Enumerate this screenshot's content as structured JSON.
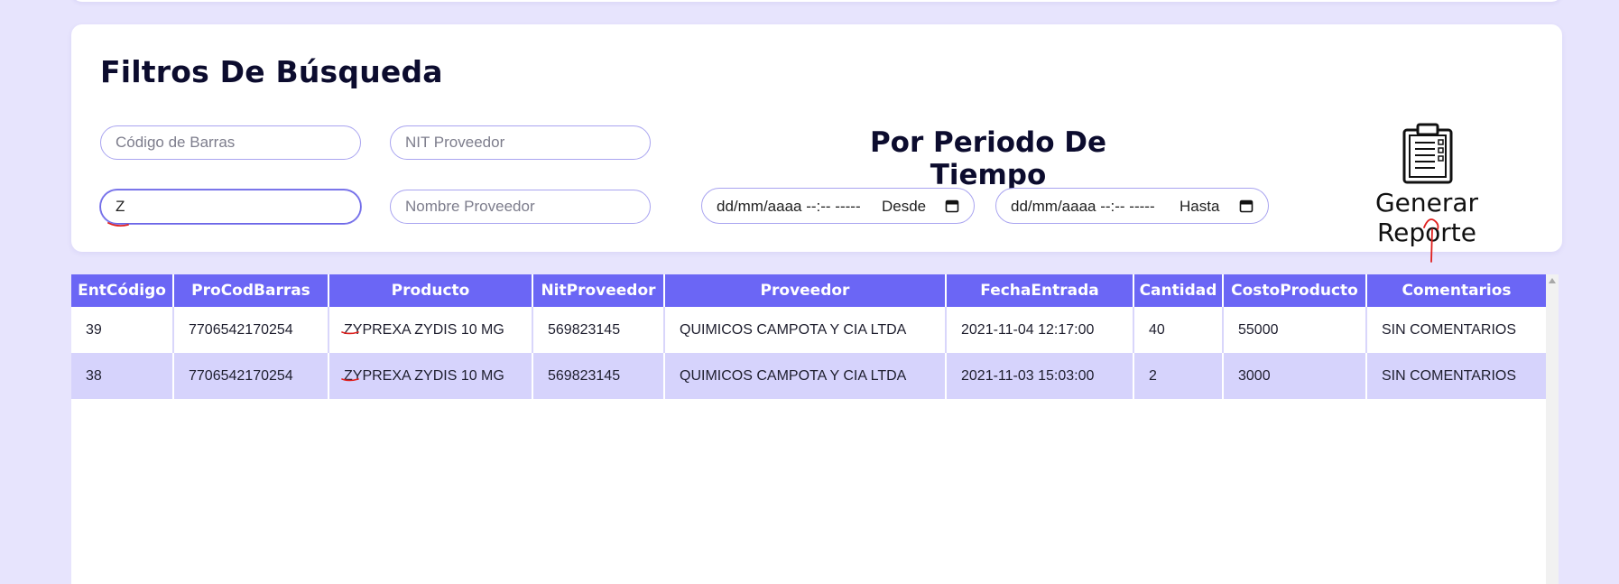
{
  "filters": {
    "title": "Filtros De Búsqueda",
    "barcode_placeholder": "Código de Barras",
    "nit_placeholder": "NIT Proveedor",
    "product_value": "Z",
    "provider_name_placeholder": "Nombre Proveedor"
  },
  "period": {
    "title": "Por Periodo De Tiempo",
    "from_placeholder": "dd/mm/aaaa --:-- -----",
    "from_label": "Desde",
    "to_placeholder": "dd/mm/aaaa --:-- -----",
    "to_label": "Hasta"
  },
  "report": {
    "label": "Generar Reporte",
    "icon": "clipboard-icon"
  },
  "table": {
    "columns": [
      "EntCódigo",
      "ProCodBarras",
      "Producto",
      "NitProveedor",
      "Proveedor",
      "FechaEntrada",
      "Cantidad",
      "CostoProducto",
      "Comentarios"
    ],
    "rows": [
      [
        "39",
        "7706542170254",
        "ZYPREXA ZYDIS 10 MG",
        "569823145",
        "QUIMICOS CAMPOTA Y CIA LTDA",
        "2021-11-04 12:17:00",
        "40",
        "55000",
        "SIN COMENTARIOS"
      ],
      [
        "38",
        "7706542170254",
        "ZYPREXA ZYDIS 10 MG",
        "569823145",
        "QUIMICOS CAMPOTA Y CIA LTDA",
        "2021-11-03 15:03:00",
        "2",
        "3000",
        "SIN COMENTARIOS"
      ]
    ]
  },
  "colors": {
    "page_bg": "#e7e4fd",
    "header_bg": "#6b66f5",
    "alt_row_bg": "#d6d3fc",
    "annotation": "#e0201e"
  }
}
